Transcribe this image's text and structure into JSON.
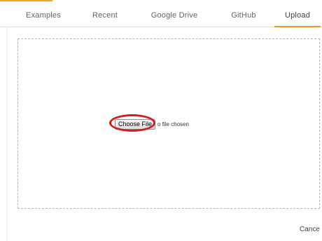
{
  "tabs": [
    {
      "label": "Examples"
    },
    {
      "label": "Recent"
    },
    {
      "label": "Google Drive"
    },
    {
      "label": "GitHub"
    },
    {
      "label": "Upload",
      "active": true
    }
  ],
  "upload": {
    "choose_file_label": "Choose File",
    "no_file_text": "o file chosen"
  },
  "footer": {
    "cancel_label": "Cance"
  },
  "colors": {
    "active_tab_accent": "#f29900",
    "annotation_circle": "#d01f1f"
  }
}
